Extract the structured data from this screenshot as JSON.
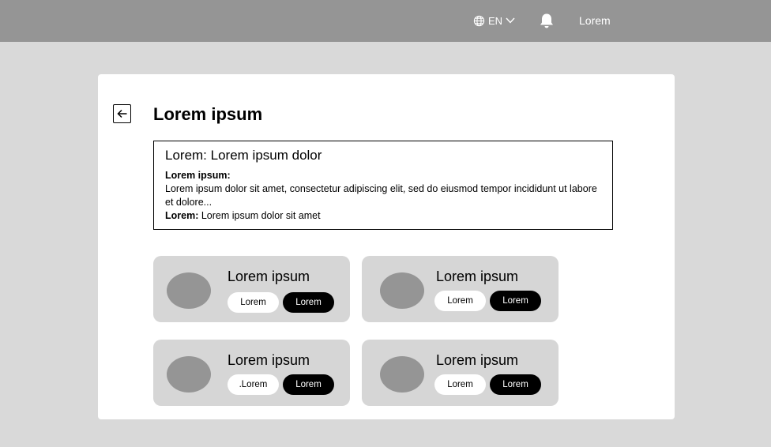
{
  "header": {
    "language": "EN",
    "user_label": "Lorem"
  },
  "page": {
    "title": "Lorem ipsum",
    "info": {
      "heading": "Lorem: Lorem ipsum dolor",
      "label1": "Lorem ipsum:",
      "text1": "Lorem ipsum dolor sit amet, consectetur adipiscing elit, sed do eiusmod tempor incididunt ut labore et dolore...",
      "label2": "Lorem:",
      "text2": "Lorem ipsum dolor sit amet"
    },
    "items": [
      {
        "title": "Lorem ipsum",
        "btn_light": "Lorem",
        "btn_dark": "Lorem"
      },
      {
        "title": "Lorem ipsum",
        "btn_light": "Lorem",
        "btn_dark": "Lorem"
      },
      {
        "title": "Lorem ipsum",
        "btn_light": ".Lorem",
        "btn_dark": "Lorem"
      },
      {
        "title": "Lorem ipsum",
        "btn_light": "Lorem",
        "btn_dark": "Lorem"
      }
    ]
  }
}
